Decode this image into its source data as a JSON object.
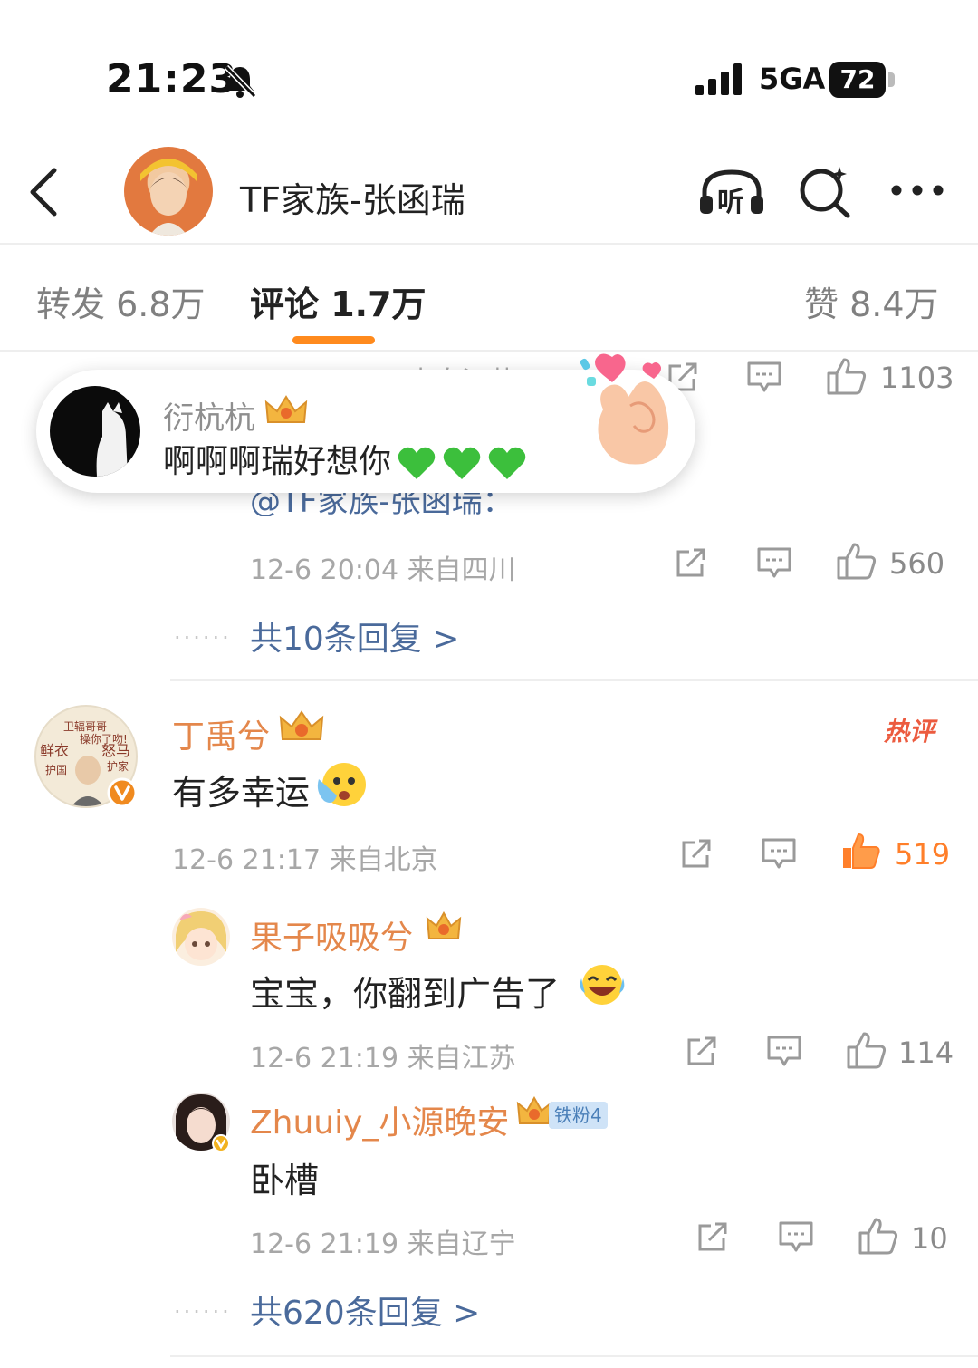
{
  "status_bar": {
    "time": "21:23",
    "network": "5GA",
    "battery": "72",
    "mute_icon": "bell-slash-icon",
    "signal_icon": "signal-icon"
  },
  "header": {
    "title": "TF家族-张函瑞",
    "back_icon": "chevron-left-icon",
    "listen_label": "听",
    "search_icon": "search-icon",
    "more_icon": "ellipsis-icon"
  },
  "tabs": {
    "repost": "转发 6.8万",
    "comments": "评论 1.7万",
    "likes": "赞 8.4万"
  },
  "popup": {
    "user": "衍杭杭",
    "text": "啊啊啊瑞好想你",
    "heart_color": "#3cbf3c"
  },
  "thread1": {
    "partial_meta": "12-6 19:52 来自江苏",
    "partial_likes": "1103",
    "partial_mention": "@TF家族-张函瑞：",
    "meta": "12-6 20:04  来自四川",
    "likes": "560",
    "more_replies": "共10条回复 >"
  },
  "comment_main": {
    "user": "丁禹兮",
    "text": "有多幸运",
    "hot_label": "热评",
    "meta": "12-6 21:17  来自北京",
    "likes": "519",
    "like_color": "#ff7f2a"
  },
  "replies": [
    {
      "user": "果子吸吸兮",
      "text": "宝宝，你翻到广告了",
      "meta": "12-6 21:19  来自江苏",
      "likes": "114"
    },
    {
      "user": "Zhuuiy_小源晚安",
      "badge": "铁粉4",
      "text": "卧槽",
      "meta": "12-6 21:19  来自辽宁",
      "likes": "10"
    }
  ],
  "thread2": {
    "more_replies": "共620条回复 >"
  },
  "colors": {
    "accent": "#ff8a1d",
    "username": "#e4874b",
    "link": "#4a6a9b"
  }
}
